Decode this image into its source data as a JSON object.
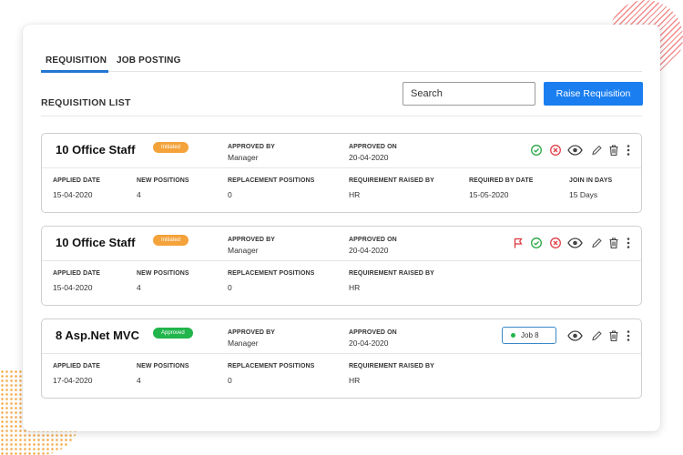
{
  "tabs": {
    "requisition": "REQUISITION",
    "job_posting": "JOB POSTING"
  },
  "list_title": "REQUISITION LIST",
  "search": {
    "placeholder": "Search"
  },
  "raise_button": "Raise Requisition",
  "labels": {
    "approved_by": "APPROVED BY",
    "approved_on": "APPROVED ON",
    "applied_date": "APPLIED DATE",
    "new_positions": "NEW POSITIONS",
    "replacement_positions": "REPLACEMENT POSITIONS",
    "requirement_raised_by": "REQUIREMENT RAISED BY",
    "required_by_date": "REQUIRED BY DATE",
    "join_in_days": "JOIN IN DAYS"
  },
  "cards": [
    {
      "title": "10 Office Staff",
      "status": "Initiated",
      "approved_by": "Manager",
      "approved_on": "20-04-2020",
      "applied_date": "15-04-2020",
      "new_positions": "4",
      "replacement_positions": "0",
      "requirement_raised_by": "HR",
      "required_by_date": "15-05-2020",
      "join_in_days": "15 Days",
      "icons": [
        "approve-icon",
        "reject-icon",
        "view-icon",
        "edit-icon",
        "delete-icon",
        "more-icon"
      ]
    },
    {
      "title": "10 Office Staff",
      "status": "Initiated",
      "approved_by": "Manager",
      "approved_on": "20-04-2020",
      "applied_date": "15-04-2020",
      "new_positions": "4",
      "replacement_positions": "0",
      "requirement_raised_by": "HR",
      "icons": [
        "flag-icon",
        "approve-icon",
        "reject-icon",
        "view-icon",
        "edit-icon",
        "delete-icon",
        "more-icon"
      ]
    },
    {
      "title": "8 Asp.Net MVC",
      "status": "Approved",
      "approved_by": "Manager",
      "approved_on": "20-04-2020",
      "applied_date": "17-04-2020",
      "new_positions": "4",
      "replacement_positions": "0",
      "requirement_raised_by": "HR",
      "job_button": "Job 8",
      "icons": [
        "view-icon",
        "edit-icon",
        "delete-icon",
        "more-icon"
      ]
    }
  ],
  "colors": {
    "accent": "#1a7ef0",
    "tab_underline": "#2176d2",
    "initiated": "#f4a23a",
    "approved": "#21b54b",
    "approve_icon": "#27a745",
    "reject_icon": "#e0404a",
    "flag_icon": "#d9363e"
  }
}
